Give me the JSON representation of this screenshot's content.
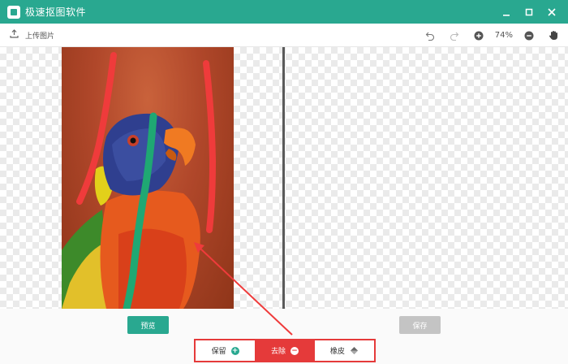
{
  "window": {
    "title": "极速抠图软件",
    "min_icon": "minimize-icon",
    "max_icon": "maximize-icon",
    "close_icon": "close-icon"
  },
  "toolbar": {
    "upload_label": "上传图片",
    "zoom": "74%",
    "undo_icon": "undo-icon",
    "redo_icon": "redo-icon",
    "zoom_in_icon": "zoom-in-icon",
    "zoom_out_icon": "zoom-out-icon",
    "hand_icon": "hand-icon"
  },
  "actions": {
    "preview_label": "预览",
    "save_label": "保存"
  },
  "brush_tools": [
    {
      "label": "保留",
      "icon": "plus-circle-icon",
      "color": "#29a890"
    },
    {
      "label": "去除",
      "icon": "minus-circle-icon",
      "color": "#e53a3a",
      "active": true
    },
    {
      "label": "橡皮",
      "icon": "eraser-icon"
    }
  ],
  "colors": {
    "accent": "#29a890",
    "remove": "#e53a3a",
    "disabled": "#c4c4c4"
  }
}
